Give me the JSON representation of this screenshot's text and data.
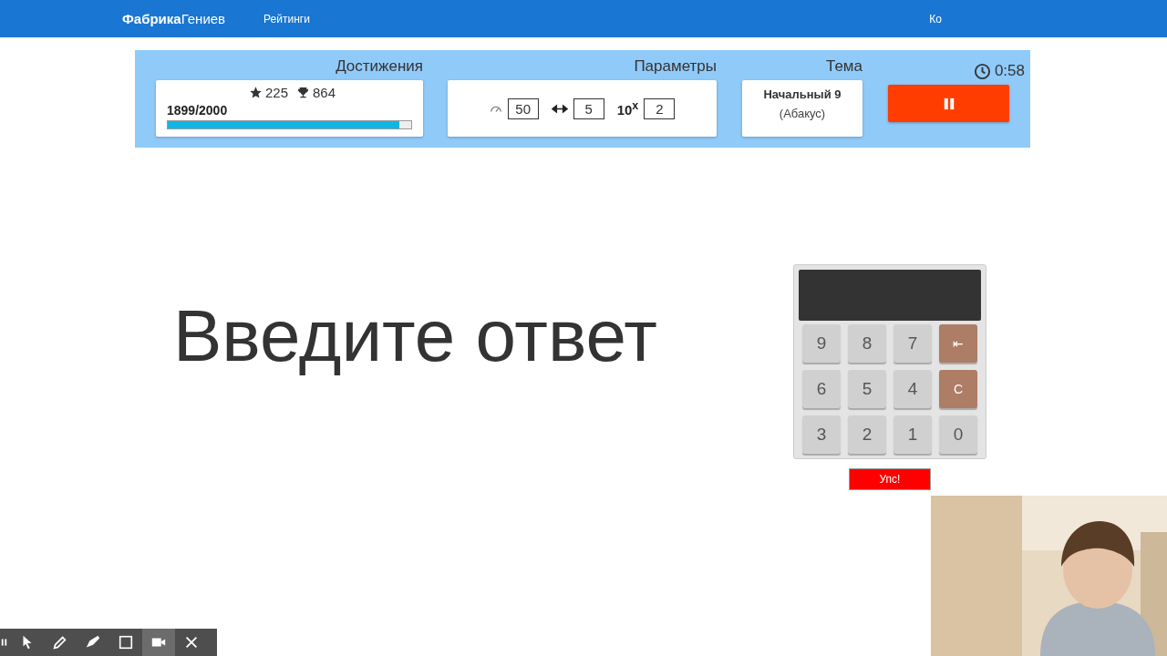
{
  "navbar": {
    "brand": "**Фабрика**Гениев",
    "links": [
      {
        "label": "Рейтинги"
      },
      {
        "label": "Ко"
      }
    ]
  },
  "panel": {
    "achievements": {
      "title": "Достижения",
      "stars": "225",
      "trophies": "864",
      "progress_text": "1899/2000",
      "level": 0.95
    },
    "parameters": {
      "title": "Параметры",
      "items": [
        {
          "kind": "speed",
          "value": "50"
        },
        {
          "kind": "length",
          "value": "5"
        },
        {
          "kind": "power",
          "label": "10$^{x}$",
          "value": "2"
        }
      ]
    },
    "theme": {
      "title": "Тема",
      "name": "Начальный 9",
      "subtitle": "(Абакус)"
    },
    "timer": {
      "time": "0:58",
      "paused": false
    }
  },
  "prompt": "Введите ответ",
  "calculator": {
    "keys": [
      {
        "label": "9",
        "kind": "digit"
      },
      {
        "label": "8",
        "kind": "digit"
      },
      {
        "label": "7",
        "kind": "digit"
      },
      {
        "label": "⇤",
        "kind": "action"
      },
      {
        "label": "6",
        "kind": "digit"
      },
      {
        "label": "5",
        "kind": "digit"
      },
      {
        "label": "4",
        "kind": "digit"
      },
      {
        "label": "C",
        "kind": "action"
      },
      {
        "label": "3",
        "kind": "digit"
      },
      {
        "label": "2",
        "kind": "digit"
      },
      {
        "label": "1",
        "kind": "digit"
      },
      {
        "label": "0",
        "kind": "digit"
      }
    ]
  },
  "oops_button": "Упс!",
  "recorder_toolbar": {
    "tools": [
      {
        "kind": "pause",
        "selected": false
      },
      {
        "kind": "pointer",
        "selected": false
      },
      {
        "kind": "pen",
        "selected": false
      },
      {
        "kind": "highlighter",
        "selected": false
      },
      {
        "kind": "rectangle",
        "selected": false
      },
      {
        "kind": "camera",
        "selected": true
      },
      {
        "kind": "close",
        "selected": false
      }
    ]
  }
}
